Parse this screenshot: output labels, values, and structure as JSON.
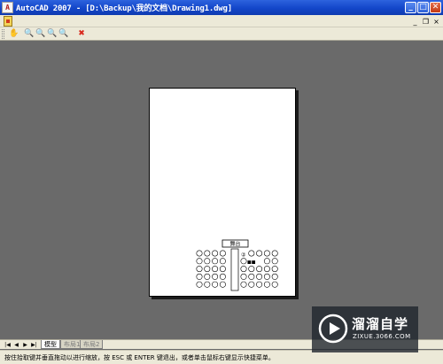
{
  "window": {
    "app_icon_text": "A",
    "title": "AutoCAD 2007 - [D:\\Backup\\我的文档\\Drawing1.dwg]",
    "minimize": "_",
    "maximize": "□",
    "close": "✕"
  },
  "document_controls": {
    "minimize": "_",
    "restore": "❐",
    "close": "×"
  },
  "toolbar": {
    "items": [
      {
        "name": "pan-icon",
        "glyph": "✋"
      },
      {
        "name": "zoom-realtime-icon",
        "glyph": "🔍"
      },
      {
        "name": "zoom-window-icon",
        "glyph": "🔍"
      },
      {
        "name": "zoom-in-icon",
        "glyph": "🔍"
      },
      {
        "name": "zoom-out-icon",
        "glyph": "🔍"
      },
      {
        "name": "close-preview-icon",
        "glyph": "✖"
      }
    ],
    "close_color": "#d8281c"
  },
  "drawing": {
    "stage_label": "舞台",
    "marker_left": "②",
    "marker_right": "■■",
    "seats_left_rows": 5,
    "seats_left_cols": 4,
    "seats_right_rows": 5,
    "seats_right_cols": 5
  },
  "tabs": {
    "nav": [
      "|◀",
      "◀",
      "▶",
      "▶|"
    ],
    "items": [
      {
        "label": "模型",
        "active": true
      },
      {
        "label": "布局1",
        "active": false
      },
      {
        "label": "布局2",
        "active": false
      }
    ]
  },
  "status": {
    "text": "按住拾取键并垂直拖动以进行缩放，按 ESC 或 ENTER 键退出，或者单击鼠标右键显示快捷菜单。"
  },
  "watermark": {
    "title": "溜溜自学",
    "url": "ZIXUE.3066.COM"
  }
}
